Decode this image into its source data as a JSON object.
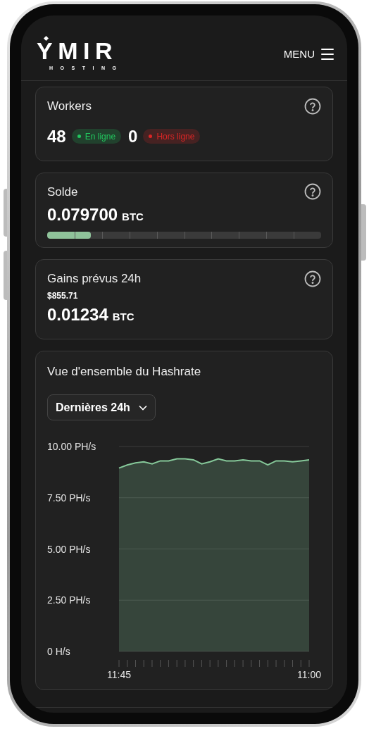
{
  "header": {
    "logo": "YMIR",
    "logo_subtitle": "HOSTING",
    "menu_label": "MENU"
  },
  "workers": {
    "title": "Workers",
    "statuses": [
      {
        "count": "48",
        "label": "En ligne",
        "color": "#22c55e"
      },
      {
        "count": "0",
        "label": "Hors ligne",
        "color": "#dc2626"
      }
    ]
  },
  "balance": {
    "title": "Solde",
    "amount": "0.079700",
    "unit": "BTC",
    "level": 0.16
  },
  "earnings": {
    "title": "Gains prévus 24h",
    "usd": "$855.71",
    "amount": "0.01234",
    "unit": "BTC"
  },
  "hashrate": {
    "title": "Vue d'ensemble du Hashrate",
    "period": "Dernières 24h",
    "chart_data": {
      "type": "area",
      "grid": true,
      "categories": [
        "11:45",
        null,
        null,
        null,
        null,
        null,
        null,
        null,
        null,
        null,
        null,
        null,
        null,
        null,
        null,
        null,
        null,
        null,
        null,
        null,
        null,
        null,
        null,
        "11:00"
      ],
      "series": [
        {
          "color": "#86c99a",
          "values": [
            8.95,
            9.1,
            9.2,
            9.25,
            9.15,
            9.3,
            9.3,
            9.4,
            9.4,
            9.35,
            9.15,
            9.25,
            9.4,
            9.3,
            9.3,
            9.35,
            9.3,
            9.3,
            9.1,
            9.3,
            9.3,
            9.25,
            9.3,
            9.35
          ]
        }
      ],
      "ylim": [
        0,
        10
      ],
      "yticks": [
        {
          "value": 0,
          "label": "0 H/s"
        },
        {
          "value": 2.5,
          "label": "2.50 PH/s"
        },
        {
          "value": 5,
          "label": "5.00 PH/s"
        },
        {
          "value": 7.5,
          "label": "7.50 PH/s"
        },
        {
          "value": 10,
          "label": "10.00 PH/s"
        }
      ]
    }
  }
}
